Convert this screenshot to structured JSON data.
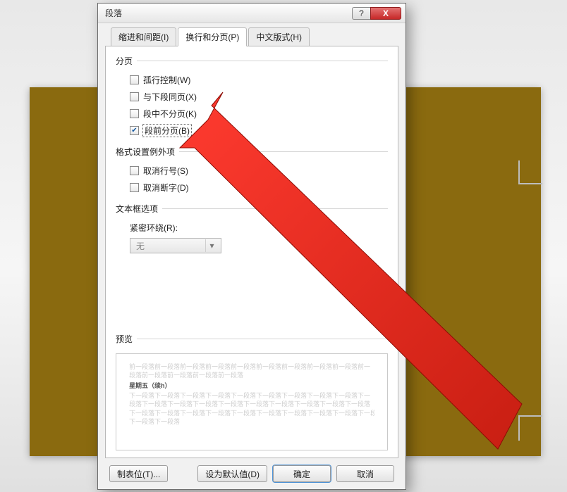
{
  "window": {
    "title": "段落",
    "help": "?",
    "close": "X"
  },
  "tabs": {
    "indent": "缩进和间距(I)",
    "pagebreak": "换行和分页(P)",
    "cjk": "中文版式(H)"
  },
  "sections": {
    "pagination": "分页",
    "exceptions": "格式设置例外项",
    "textbox": "文本框选项",
    "preview": "预览"
  },
  "checks": {
    "widow": "孤行控制(W)",
    "keep_with_next": "与下段同页(X)",
    "keep_together": "段中不分页(K)",
    "page_break_before": "段前分页(B)",
    "suppress_line_numbers": "取消行号(S)",
    "suppress_hyphenation": "取消断字(D)"
  },
  "textbox": {
    "tight_wrap_label": "紧密环绕(R):",
    "tight_wrap_value": "无"
  },
  "preview": {
    "placeholder_a": "前一段落前一段落前一段落前一段落前一段落前一段落前一段落前一段落前一段落前一",
    "placeholder_b": "段落前一段落前一段落前一段落前一段落",
    "sample": "星期五（续h）",
    "placeholder_c": "下一段落下一段落下一段落下一段落下一段落下一段落下一段落下一段落下一段落下一",
    "placeholder_d": "段落下一段落下一段落下一段落下一段落下一段落下一段落下一段落下一段落下一段落",
    "placeholder_e": "下一段落下一段落下一段落下一段落下一段落下一段落下一段落下一段落下一段落下一段落",
    "placeholder_f": "下一段落下一段落"
  },
  "buttons": {
    "tabs": "制表位(T)...",
    "default": "设为默认值(D)",
    "ok": "确定",
    "cancel": "取消"
  }
}
